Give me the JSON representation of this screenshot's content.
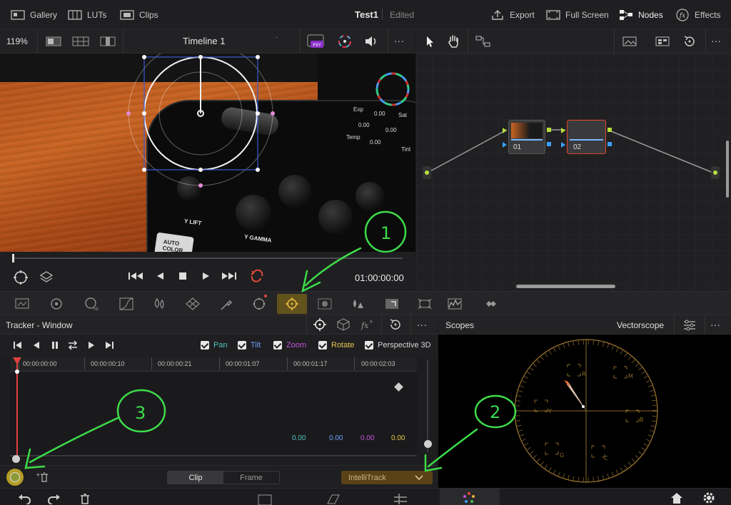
{
  "topbar": {
    "gallery": "Gallery",
    "luts": "LUTs",
    "clips": "Clips",
    "project_title": "Test1",
    "project_status": "Edited",
    "export": "Export",
    "full_screen": "Full Screen",
    "nodes": "Nodes",
    "effects": "Effects"
  },
  "viewer": {
    "zoom": "119%",
    "timeline_name": "Timeline 1",
    "more": "···",
    "timecode": "01:00:00:00",
    "device_labels": [
      "Y LIFT",
      "Y GAMMA",
      "AUTO COLOR"
    ],
    "device_values": [
      "Exp",
      "0.00",
      "Sat",
      "0.00",
      "0.00",
      "Temp",
      "0.00",
      "Tint"
    ]
  },
  "node_editor": {
    "more": "···",
    "nodes": [
      {
        "label": "01"
      },
      {
        "label": "02"
      }
    ]
  },
  "tracker": {
    "title": "Tracker - Window",
    "more": "···",
    "checkboxes": [
      {
        "label": "Pan",
        "color": "#4fc3c0"
      },
      {
        "label": "Tilt",
        "color": "#6fa0ff"
      },
      {
        "label": "Zoom",
        "color": "#c252d9"
      },
      {
        "label": "Rotate",
        "color": "#e6c84a"
      },
      {
        "label": "Perspective 3D",
        "color": "#d8d8d8"
      }
    ],
    "ruler_ticks": [
      "00:00:00:00",
      "00:00:00:10",
      "00:00:00:21",
      "00:00:01:07",
      "00:00:01:17",
      "00:00:02:03"
    ],
    "values": [
      {
        "text": "0.00",
        "color": "#4fc3c0"
      },
      {
        "text": "0.00",
        "color": "#6fa0ff"
      },
      {
        "text": "0.00",
        "color": "#c252d9"
      },
      {
        "text": "0.00",
        "color": "#e6c84a"
      }
    ],
    "mode_clip": "Clip",
    "mode_frame": "Frame",
    "track_method": "IntelliTrack"
  },
  "scopes": {
    "title": "Scopes",
    "scope_type": "Vectorscope",
    "more": "···",
    "targets": [
      "R",
      "M",
      "B",
      "C",
      "G",
      "Y"
    ]
  },
  "annotations": {
    "marks": [
      "1",
      "2",
      "3"
    ],
    "color": "#3ddc4a"
  }
}
